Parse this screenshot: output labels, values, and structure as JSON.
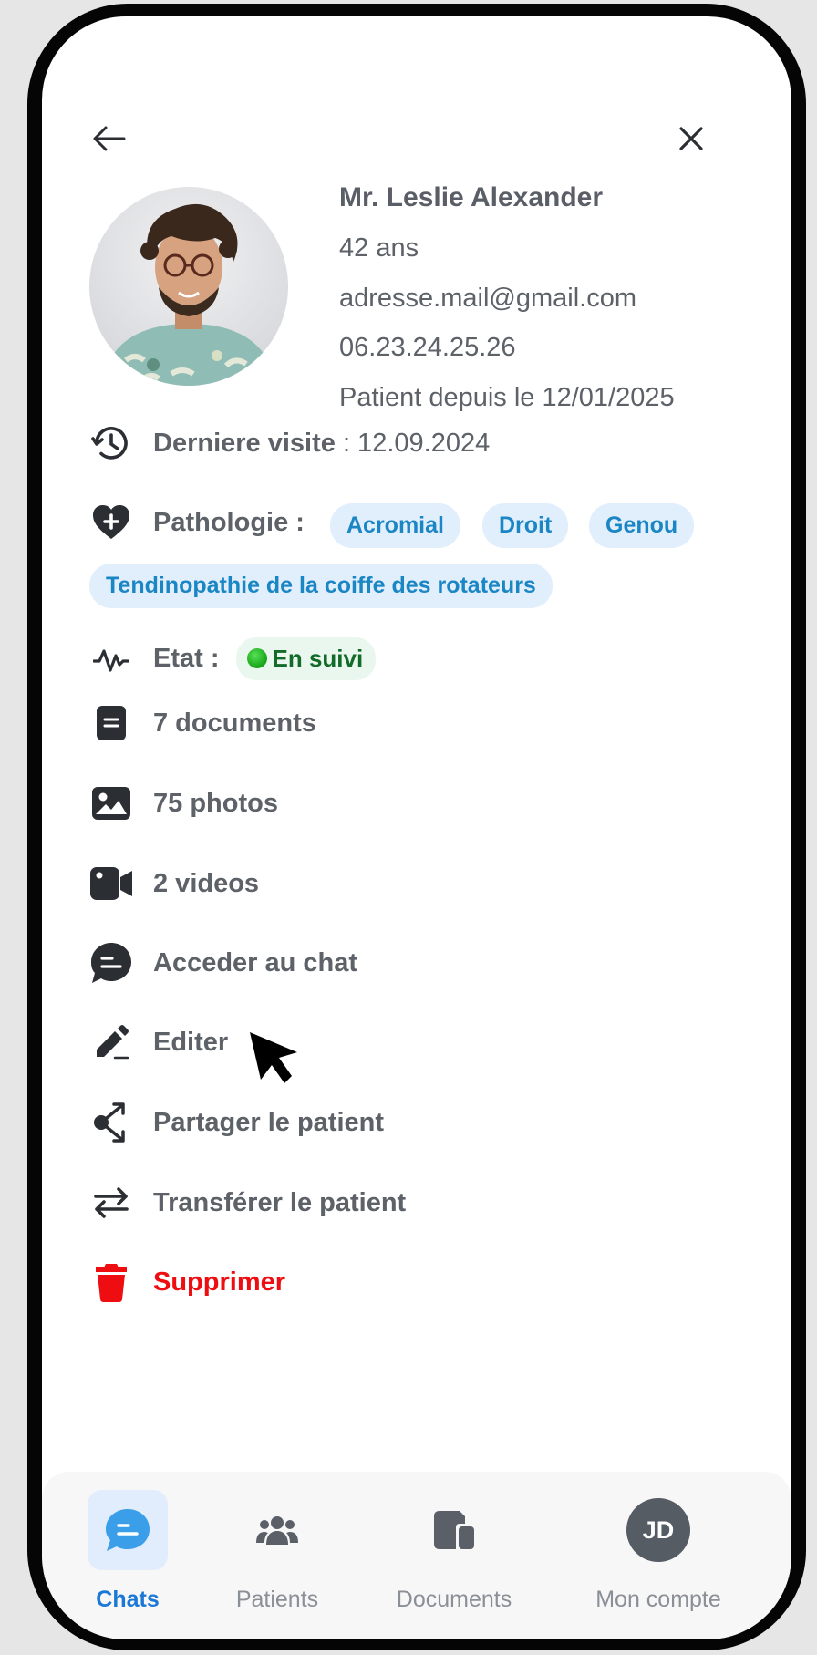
{
  "patient": {
    "name": "Mr. Leslie Alexander",
    "age": "42 ans",
    "email": "adresse.mail@gmail.com",
    "phone": "06.23.24.25.26",
    "since": "Patient depuis le 12/01/2025"
  },
  "last_visit": {
    "label": "Derniere visite",
    "value": " : 12.09.2024"
  },
  "pathology": {
    "label": "Pathologie :",
    "tags": [
      "Acromial",
      "Droit",
      "Genou",
      "Tendinopathie de la coiffe des rotateurs"
    ]
  },
  "state": {
    "label": "Etat :",
    "value": "En suivi",
    "dot_color": "#22b422"
  },
  "actions": {
    "documents": "7 documents",
    "photos": "75 photos",
    "videos": "2 videos",
    "chat": "Acceder au chat",
    "edit": "Editer",
    "share": "Partager le patient",
    "transfer": "Transférer le patient",
    "delete": "Supprimer"
  },
  "tabbar": {
    "chats": "Chats",
    "patients": "Patients",
    "documents": "Documents",
    "account": "Mon compte",
    "account_initials": "JD"
  },
  "colors": {
    "accent": "#1b78d6",
    "tag_text": "#1b86c4",
    "danger": "#ee0e12",
    "status_bg": "#eaf7ee"
  }
}
